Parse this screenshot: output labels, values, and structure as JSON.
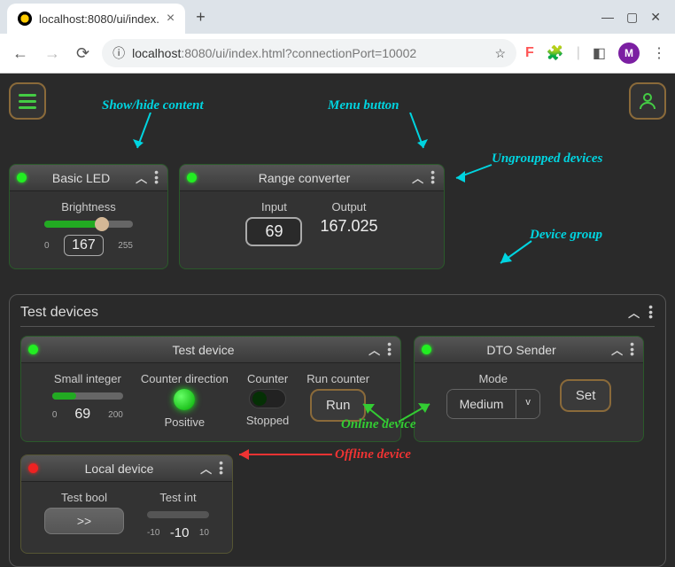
{
  "browser": {
    "tab_title": "localhost:8080/ui/index.",
    "url_host": "localhost",
    "url_path": ":8080/ui/index.html?connectionPort=10002",
    "avatar_letter": "M"
  },
  "annotations": {
    "show_hide": "Show/hide content",
    "menu_button": "Menu button",
    "ungrouped": "Ungroupped devices",
    "device_group": "Device group",
    "online_device": "Online device",
    "offline_device": "Offline device"
  },
  "cards": {
    "basic_led": {
      "title": "Basic LED",
      "brightness_label": "Brightness",
      "brightness_value": "167",
      "min": "0",
      "max": "255",
      "fill_pct": 65
    },
    "range_conv": {
      "title": "Range converter",
      "input_label": "Input",
      "input_value": "69",
      "output_label": "Output",
      "output_value": "167.025"
    }
  },
  "group": {
    "title": "Test devices",
    "test_device": {
      "title": "Test device",
      "small_int_label": "Small integer",
      "small_int_value": "69",
      "small_int_min": "0",
      "small_int_max": "200",
      "small_int_fill": 34,
      "dir_label": "Counter direction",
      "dir_value": "Positive",
      "counter_label": "Counter",
      "counter_state": "Stopped",
      "run_label": "Run counter",
      "run_btn": "Run"
    },
    "dto_sender": {
      "title": "DTO Sender",
      "mode_label": "Mode",
      "mode_value": "Medium",
      "set_btn": "Set"
    },
    "local_device": {
      "title": "Local device",
      "bool_label": "Test bool",
      "bool_value": ">>",
      "int_label": "Test int",
      "int_value": "-10",
      "int_min": "-10",
      "int_max": "10"
    }
  }
}
